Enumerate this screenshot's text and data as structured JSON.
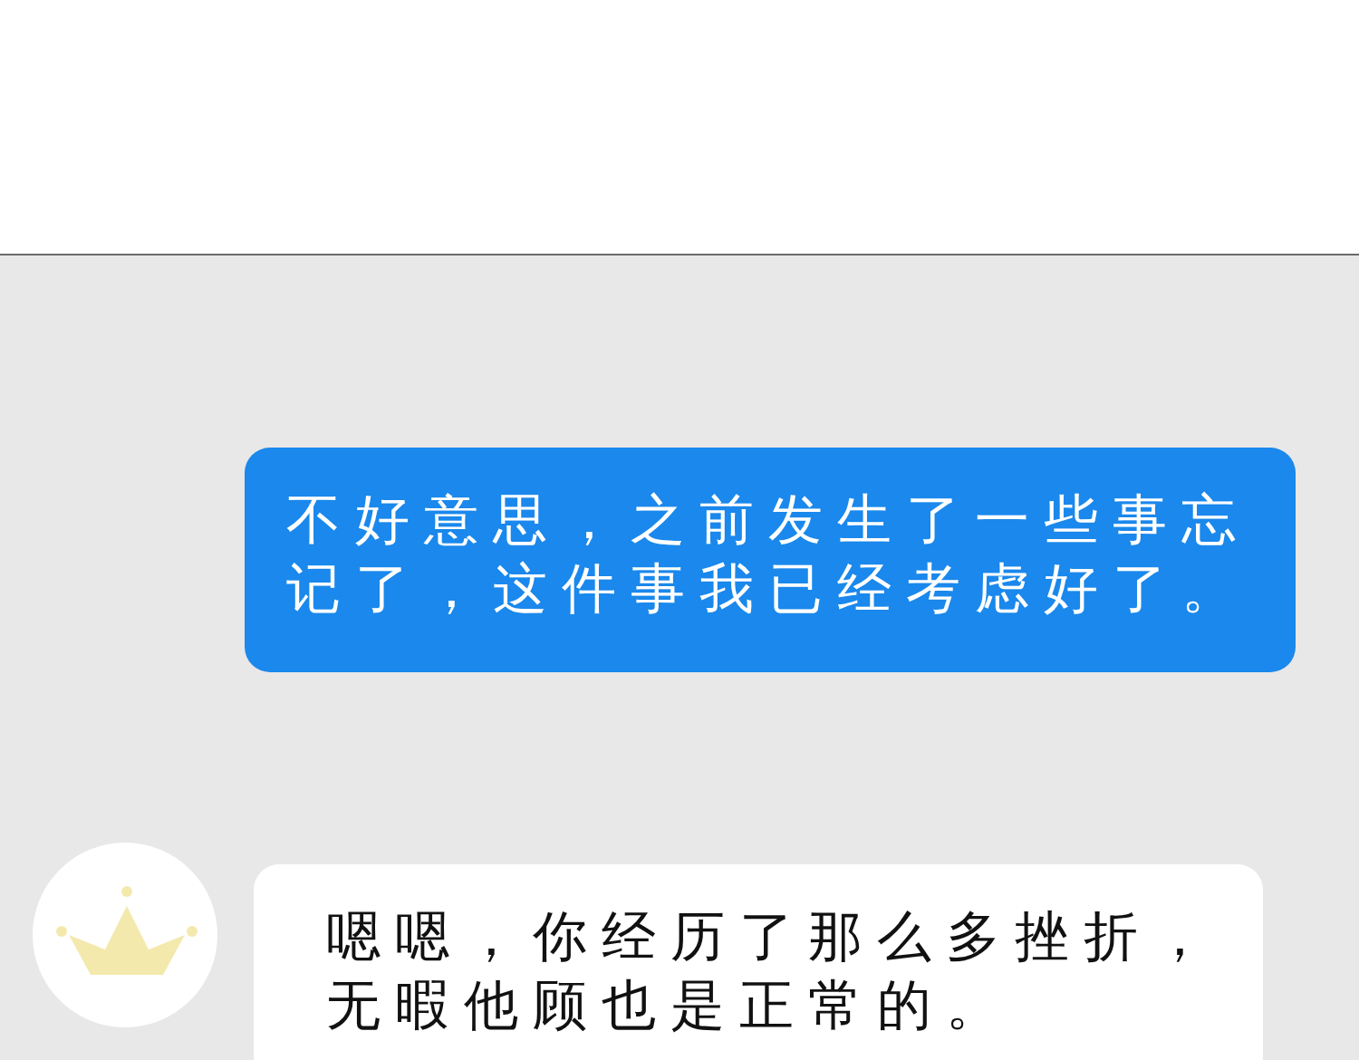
{
  "messages": [
    {
      "kind": "outgoing",
      "text": "不好意思，之前发生了一些事忘记了，这件事我已经考虑好了。"
    },
    {
      "kind": "incoming",
      "text": "嗯嗯，你经历了那么多挫折，无暇他顾也是正常的。"
    }
  ]
}
